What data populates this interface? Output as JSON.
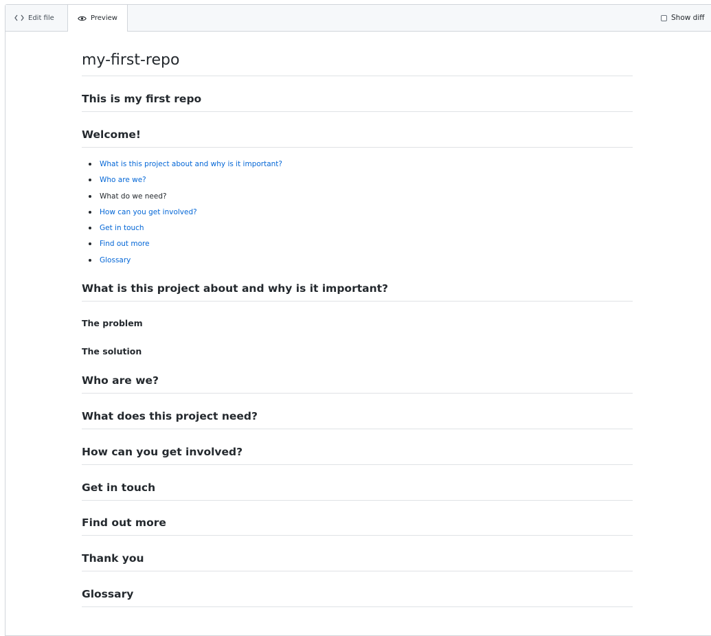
{
  "tabs": {
    "edit_label": "Edit file",
    "preview_label": "Preview",
    "show_diff_label": "Show diff"
  },
  "doc": {
    "title": "my-first-repo",
    "subtitle": "This is my first repo",
    "welcome": "Welcome!",
    "toc": [
      {
        "label": "What is this project about and why is it important?",
        "link": true
      },
      {
        "label": "Who are we?",
        "link": true
      },
      {
        "label": "What do we need?",
        "link": false
      },
      {
        "label": "How can you get involved?",
        "link": true
      },
      {
        "label": "Get in touch",
        "link": true
      },
      {
        "label": "Find out more",
        "link": true
      },
      {
        "label": "Glossary",
        "link": true
      }
    ],
    "sections": {
      "about": "What is this project about and why is it important?",
      "problem": "The problem",
      "solution": "The solution",
      "who": "Who are we?",
      "need": "What does this project need?",
      "involved": "How can you get involved?",
      "touch": "Get in touch",
      "more": "Find out more",
      "thanks": "Thank you",
      "glossary": "Glossary"
    }
  },
  "colors": {
    "link": "#0366d6",
    "text": "#24292e",
    "border": "#dfe2e5"
  }
}
